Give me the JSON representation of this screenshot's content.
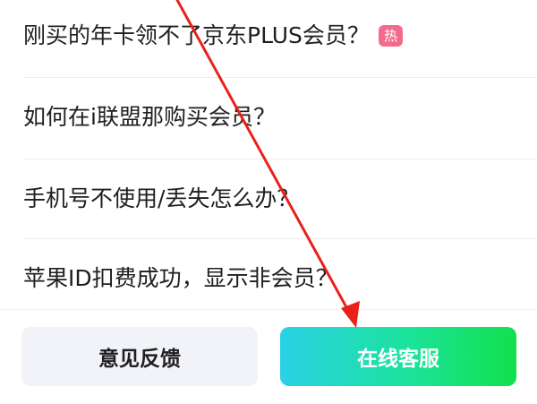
{
  "faq": {
    "items": [
      {
        "question": "刚买的年卡领不了京东PLUS会员？",
        "badge": "热"
      },
      {
        "question": "如何在i联盟那购买会员？"
      },
      {
        "question": "手机号不使用/丢失怎么办？"
      },
      {
        "question": "苹果ID扣费成功，显示非会员？"
      }
    ]
  },
  "footer": {
    "feedback_label": "意见反馈",
    "service_label": "在线客服"
  },
  "colors": {
    "hot_badge": "#f56a8a",
    "service_gradient_start": "#2ad1e6",
    "service_gradient_end": "#12e04c",
    "annotation_arrow": "#e8221b"
  }
}
